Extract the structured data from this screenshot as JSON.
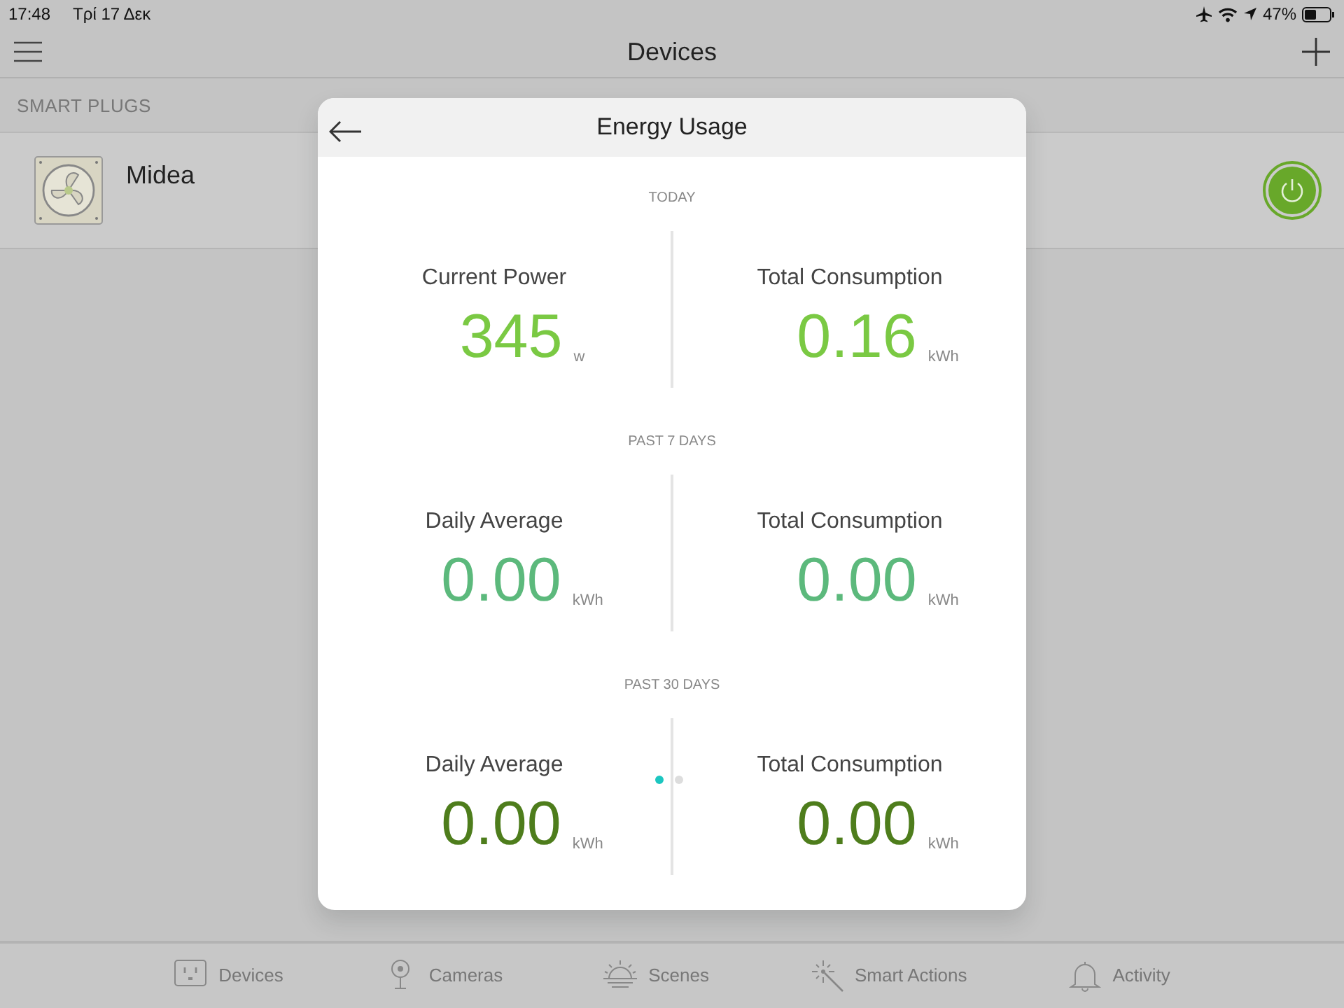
{
  "status_bar": {
    "time": "17:48",
    "date": "Τρί 17 Δεκ",
    "battery_text": "47%"
  },
  "header": {
    "title": "Devices"
  },
  "section_label": "SMART PLUGS",
  "devices": [
    {
      "name": "Midea",
      "on": true
    }
  ],
  "modal": {
    "title": "Energy Usage",
    "sections": [
      {
        "label": "TODAY",
        "color": "#7ac943",
        "metrics": [
          {
            "label": "Current Power",
            "value": "345",
            "unit": "w"
          },
          {
            "label": "Total Consumption",
            "value": "0.16",
            "unit": "kWh"
          }
        ]
      },
      {
        "label": "PAST 7 DAYS",
        "color": "#5cb97c",
        "metrics": [
          {
            "label": "Daily Average",
            "value": "0.00",
            "unit": "kWh"
          },
          {
            "label": "Total Consumption",
            "value": "0.00",
            "unit": "kWh"
          }
        ]
      },
      {
        "label": "PAST 30 DAYS",
        "color": "#4e7d1c",
        "metrics": [
          {
            "label": "Daily Average",
            "value": "0.00",
            "unit": "kWh"
          },
          {
            "label": "Total Consumption",
            "value": "0.00",
            "unit": "kWh"
          }
        ]
      }
    ],
    "pages": [
      {
        "selected": true
      },
      {
        "selected": false
      }
    ]
  },
  "tabs": [
    {
      "kind": "plug",
      "label": "Devices"
    },
    {
      "kind": "camera",
      "label": "Cameras"
    },
    {
      "kind": "sun",
      "label": "Scenes"
    },
    {
      "kind": "wand",
      "label": "Smart Actions"
    },
    {
      "kind": "bell",
      "label": "Activity"
    }
  ]
}
